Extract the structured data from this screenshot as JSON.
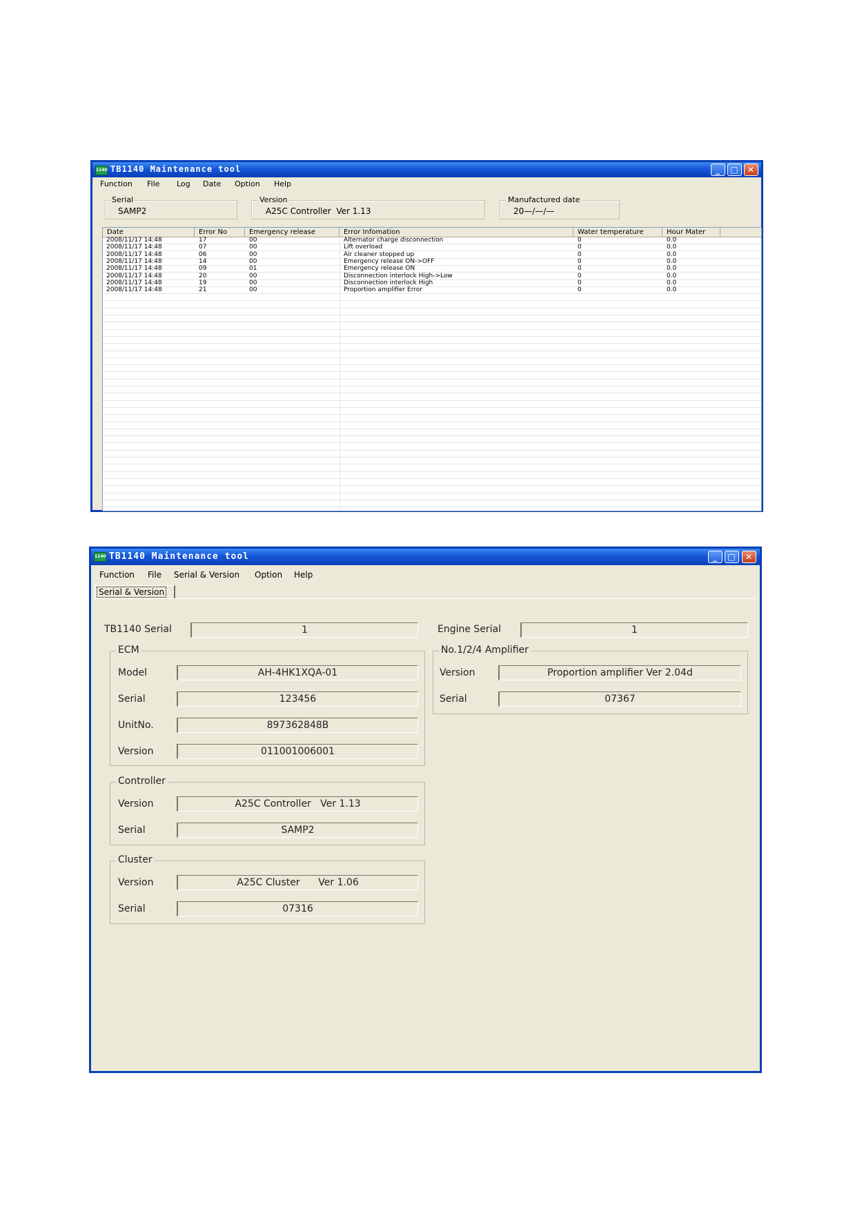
{
  "window1": {
    "title": "TB1140 Maintenance tool",
    "app_icon_text": "1140",
    "menu": [
      "Function",
      "File",
      "Log",
      "Date",
      "Option",
      "Help"
    ],
    "serial": {
      "label": "Serial",
      "value": "SAMP2"
    },
    "version": {
      "label": "Version",
      "value": "A25C Controller  Ver 1.13"
    },
    "manufactured": {
      "label": "Manufactured date",
      "value": "20—/—/—"
    },
    "columns": [
      "Date",
      "Error No",
      "Emergency release",
      "Error Infomation",
      "Water temperature",
      "Hour Mater"
    ],
    "rows": [
      [
        "2008/11/17 14:48",
        "17",
        "00",
        "Alternator charge disconnection",
        "0",
        "0.0"
      ],
      [
        "2008/11/17 14:48",
        "07",
        "00",
        "Lift overload",
        "0",
        "0.0"
      ],
      [
        "2008/11/17 14:48",
        "06",
        "00",
        "Air cleaner stopped up",
        "0",
        "0.0"
      ],
      [
        "2008/11/17 14:48",
        "14",
        "00",
        "Emergency release ON->OFF",
        "0",
        "0.0"
      ],
      [
        "2008/11/17 14:48",
        "09",
        "01",
        "Emergency release ON",
        "0",
        "0.0"
      ],
      [
        "2008/11/17 14:48",
        "20",
        "00",
        "Disconnection interlock High->Low",
        "0",
        "0.0"
      ],
      [
        "2008/11/17 14:48",
        "19",
        "00",
        "Disconnection interlock High",
        "0",
        "0.0"
      ],
      [
        "2008/11/17 14:48",
        "21",
        "00",
        "Proportion amplifier Error",
        "0",
        "0.0"
      ]
    ]
  },
  "window2": {
    "title": "TB1140 Maintenance tool",
    "app_icon_text": "1140",
    "menu": [
      "Function",
      "File",
      "Serial & Version",
      "Option",
      "Help"
    ],
    "tab": "Serial & Version",
    "tb_serial": {
      "label": "TB1140 Serial",
      "value": "1"
    },
    "engine_serial": {
      "label": "Engine Serial",
      "value": "1"
    },
    "ecm": {
      "label": "ECM",
      "model": {
        "label": "Model",
        "value": "AH-4HK1XQA-01"
      },
      "serial": {
        "label": "Serial",
        "value": "123456"
      },
      "unitno": {
        "label": "UnitNo.",
        "value": "897362848B"
      },
      "version": {
        "label": "Version",
        "value": "011001006001"
      }
    },
    "controller": {
      "label": "Controller",
      "version": {
        "label": "Version",
        "value": "A25C Controller   Ver 1.13"
      },
      "serial": {
        "label": "Serial",
        "value": "SAMP2"
      }
    },
    "cluster": {
      "label": "Cluster",
      "version": {
        "label": "Version",
        "value": "A25C Cluster      Ver 1.06"
      },
      "serial": {
        "label": "Serial",
        "value": "07316"
      }
    },
    "amplifier": {
      "label": "No.1/2/4 Amplifier",
      "version": {
        "label": "Version",
        "value": "Proportion amplifier Ver 2.04d"
      },
      "serial": {
        "label": "Serial",
        "value": "07367"
      }
    }
  }
}
